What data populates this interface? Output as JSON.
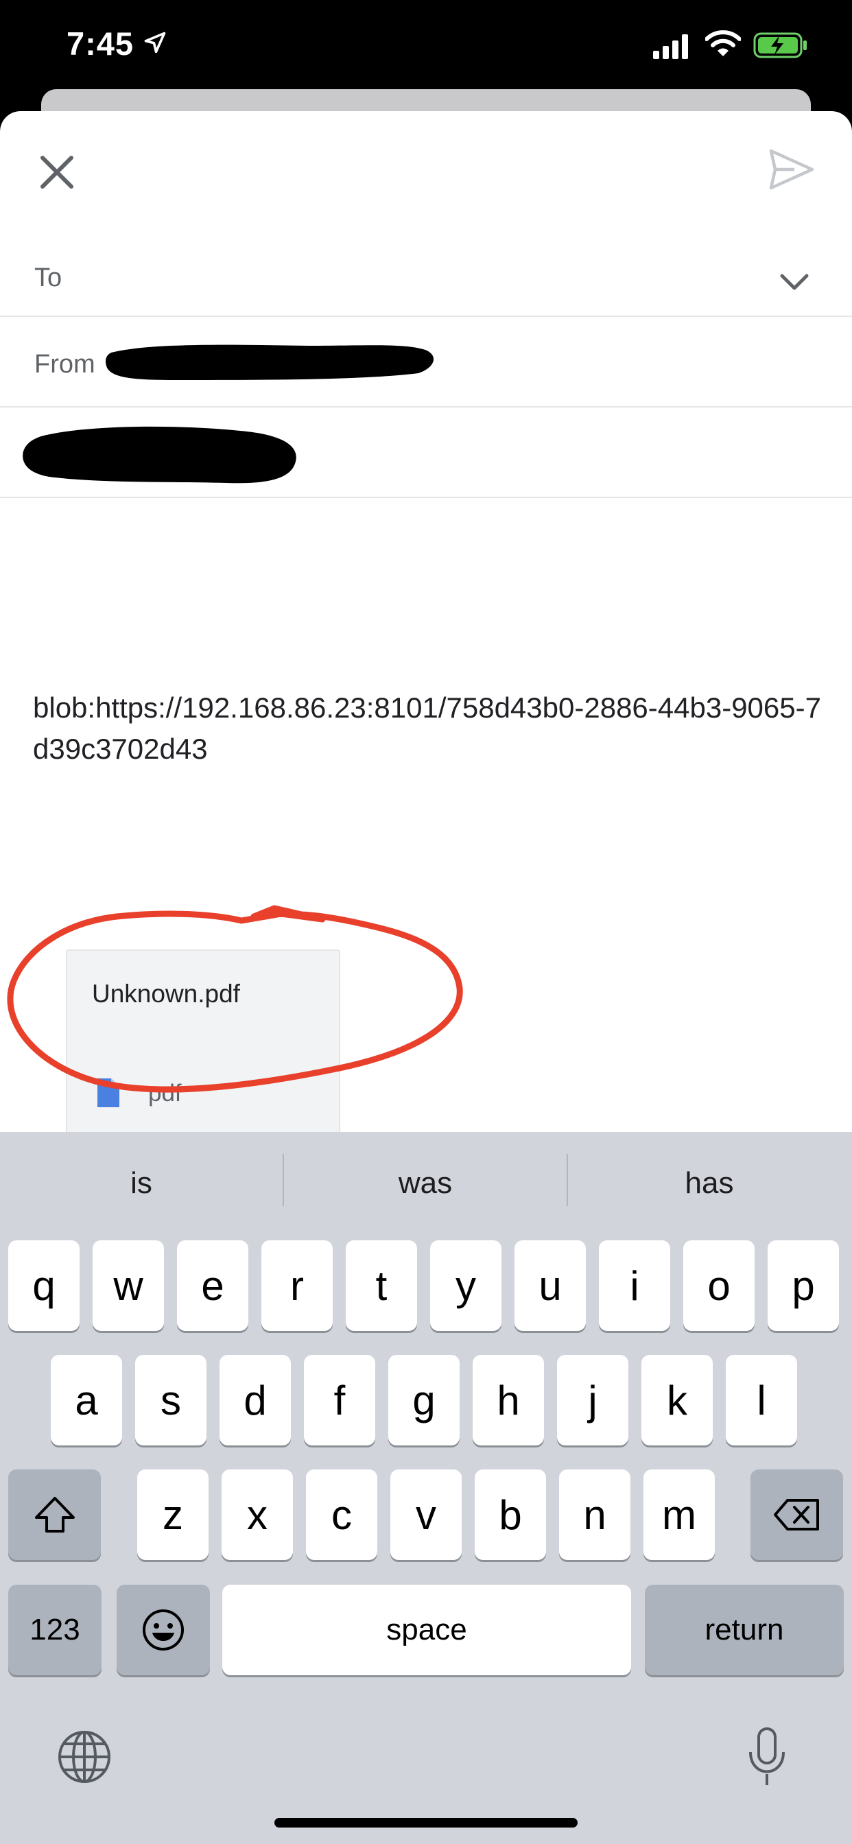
{
  "status_bar": {
    "time": "7:45"
  },
  "compose": {
    "to_label": "To",
    "from_label": "From",
    "body": "blob:https://192.168.86.23:8101/758d43b0-2886-44b3-9065-7d39c3702d43",
    "attachment": {
      "name": "Unknown.pdf",
      "type": "pdf"
    },
    "colors": {
      "annotation": "#e8402b",
      "file_icon": "#4a80e0"
    }
  },
  "keyboard": {
    "suggestions": [
      "is",
      "was",
      "has"
    ],
    "rows": [
      [
        "q",
        "w",
        "e",
        "r",
        "t",
        "y",
        "u",
        "i",
        "o",
        "p"
      ],
      [
        "a",
        "s",
        "d",
        "f",
        "g",
        "h",
        "j",
        "k",
        "l"
      ],
      [
        "z",
        "x",
        "c",
        "v",
        "b",
        "n",
        "m"
      ]
    ],
    "numbers_label": "123",
    "space_label": "space",
    "return_label": "return"
  }
}
